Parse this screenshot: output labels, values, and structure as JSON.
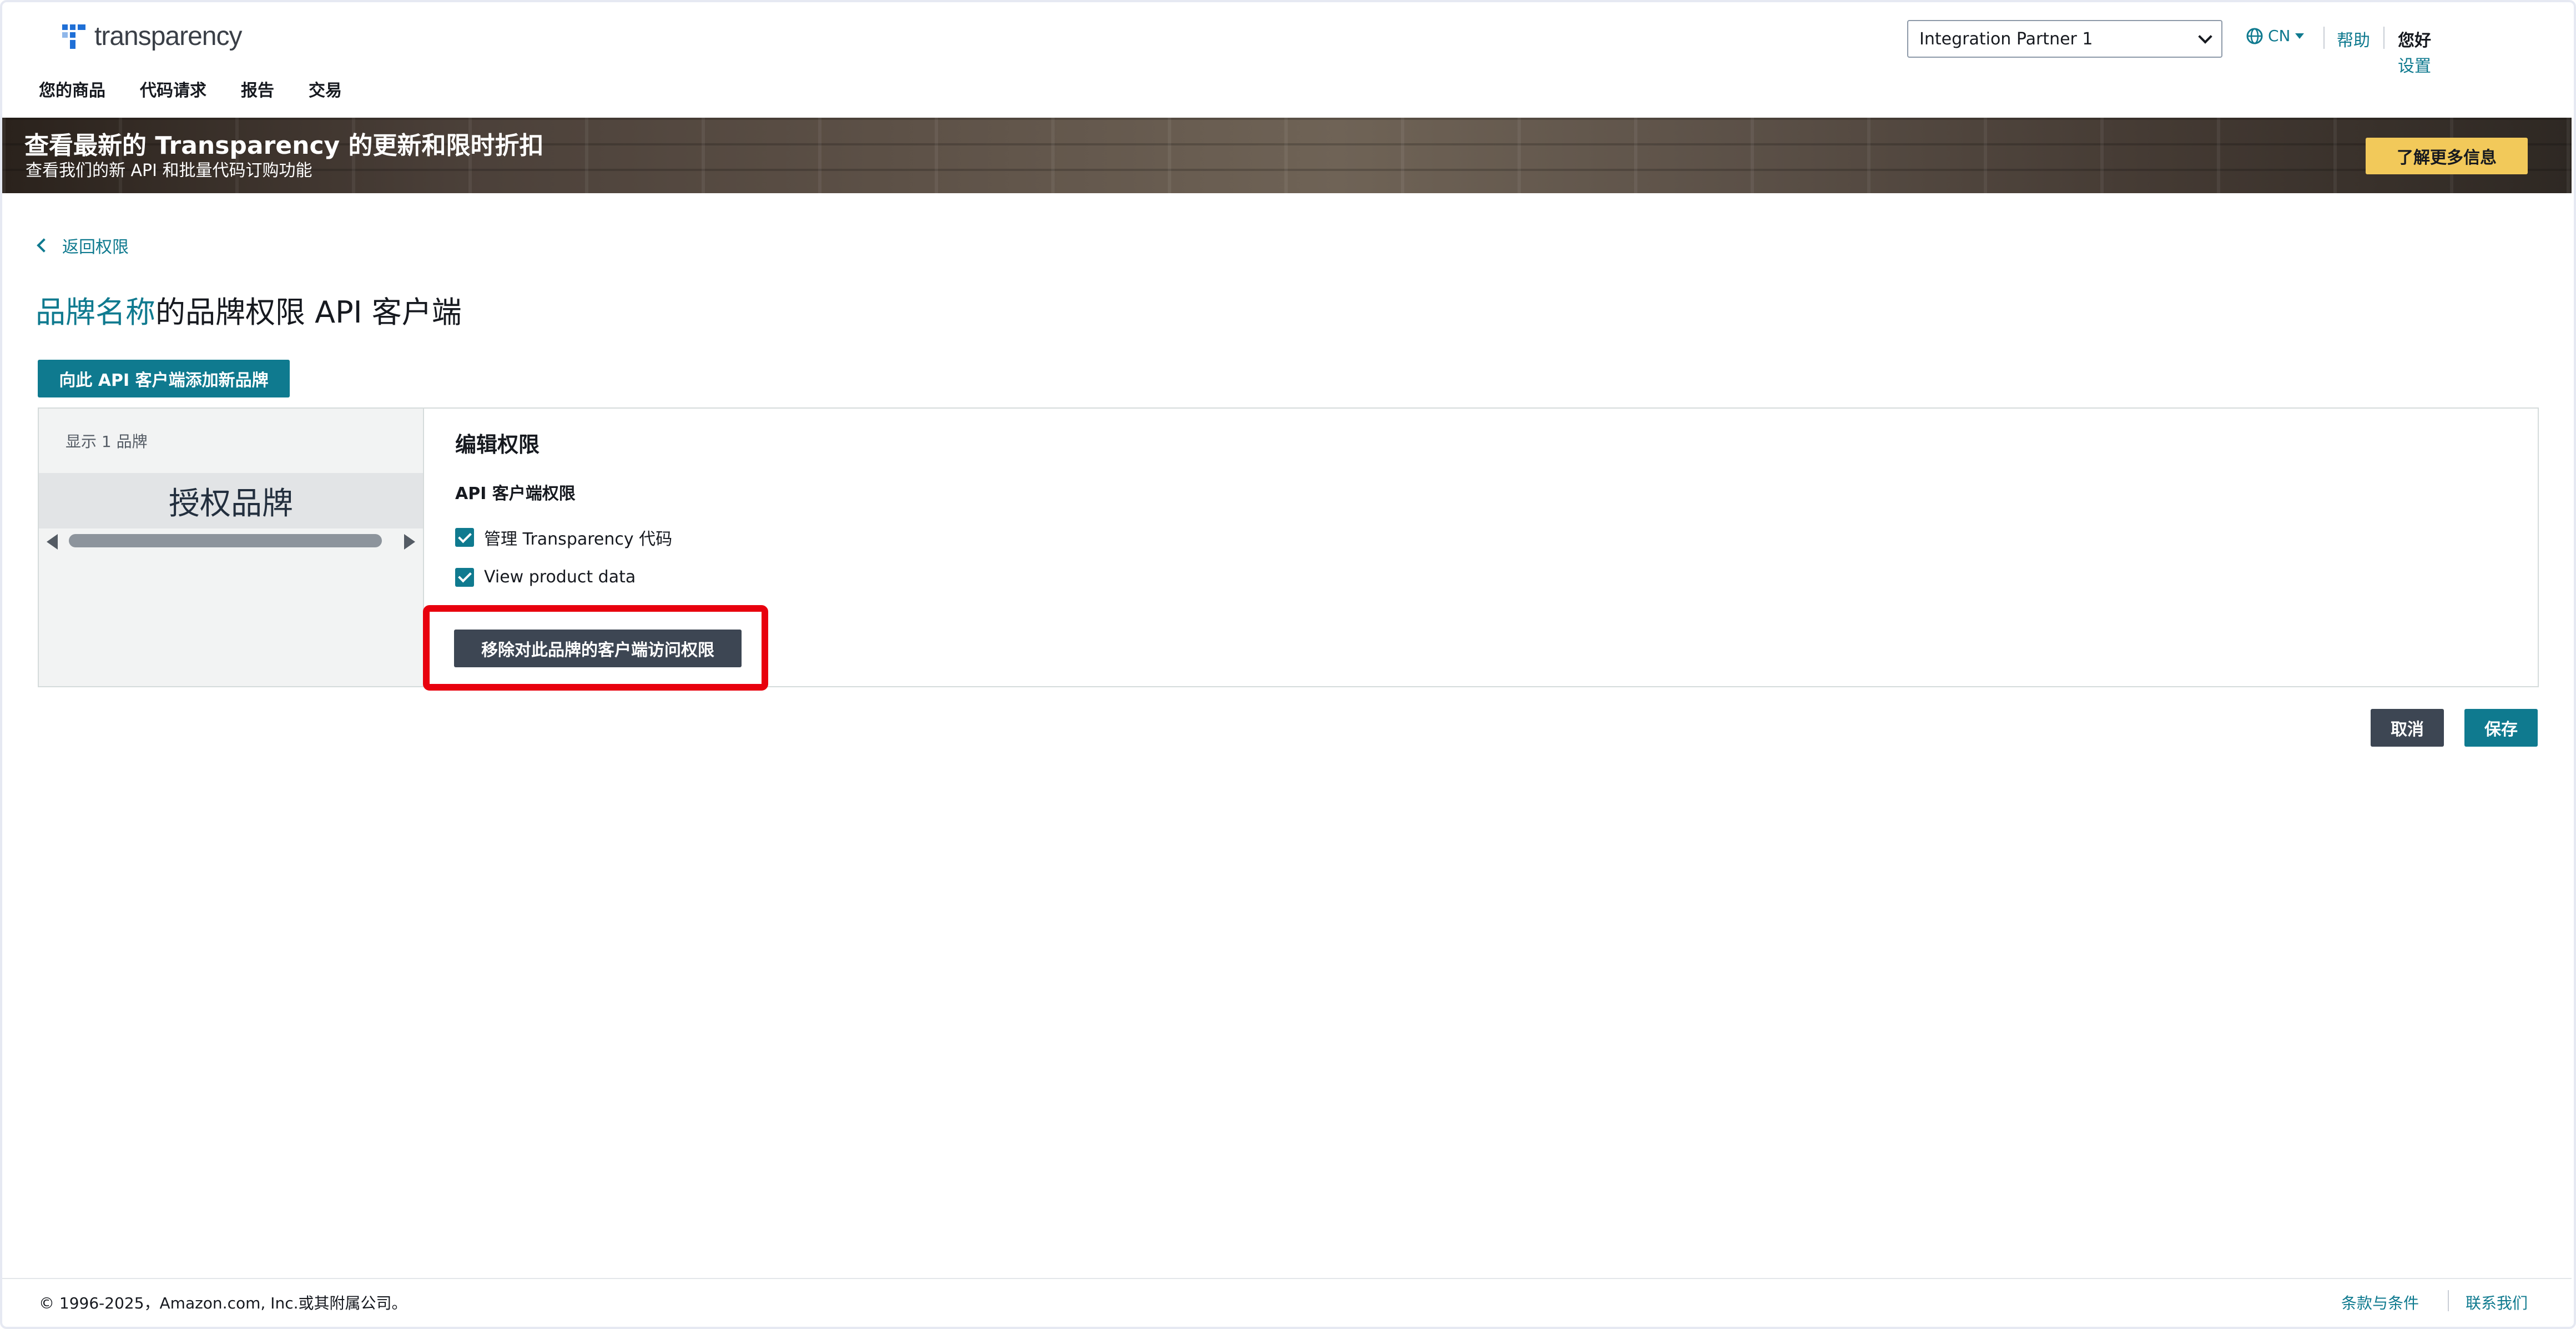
{
  "header": {
    "logo_text": "transparency",
    "nav": [
      "您的商品",
      "代码请求",
      "报告",
      "交易"
    ],
    "partner_select": "Integration Partner 1",
    "lang": "CN",
    "help": "帮助",
    "greeting": "您好",
    "settings": "设置"
  },
  "banner": {
    "title": "查看最新的 Transparency 的更新和限时折扣",
    "subtitle": "查看我们的新 API 和批量代码订购功能",
    "cta": "了解更多信息"
  },
  "main": {
    "back_link": "返回权限",
    "title_brand": "品牌名称",
    "title_rest": "的品牌权限 API 客户端",
    "add_button": "向此 API 客户端添加新品牌",
    "brand_count": "显示 1 品牌",
    "authorized_brand": "授权品牌",
    "edit_title": "编辑权限",
    "perm_section": "API 客户端权限",
    "permissions": [
      {
        "label": "管理 Transparency 代码",
        "checked": true
      },
      {
        "label": "View product data",
        "checked": true
      }
    ],
    "remove_button": "移除对此品牌的客户端访问权限",
    "cancel": "取消",
    "save": "保存"
  },
  "footer": {
    "copyright": "© 1996-2025，Amazon.com, Inc.或其附属公司。",
    "terms": "条款与条件",
    "contact": "联系我们"
  },
  "colors": {
    "accent": "#0f7a8f",
    "dark_button": "#3d4653",
    "cta_yellow": "#f2c95a",
    "highlight_red": "#e8000d"
  }
}
